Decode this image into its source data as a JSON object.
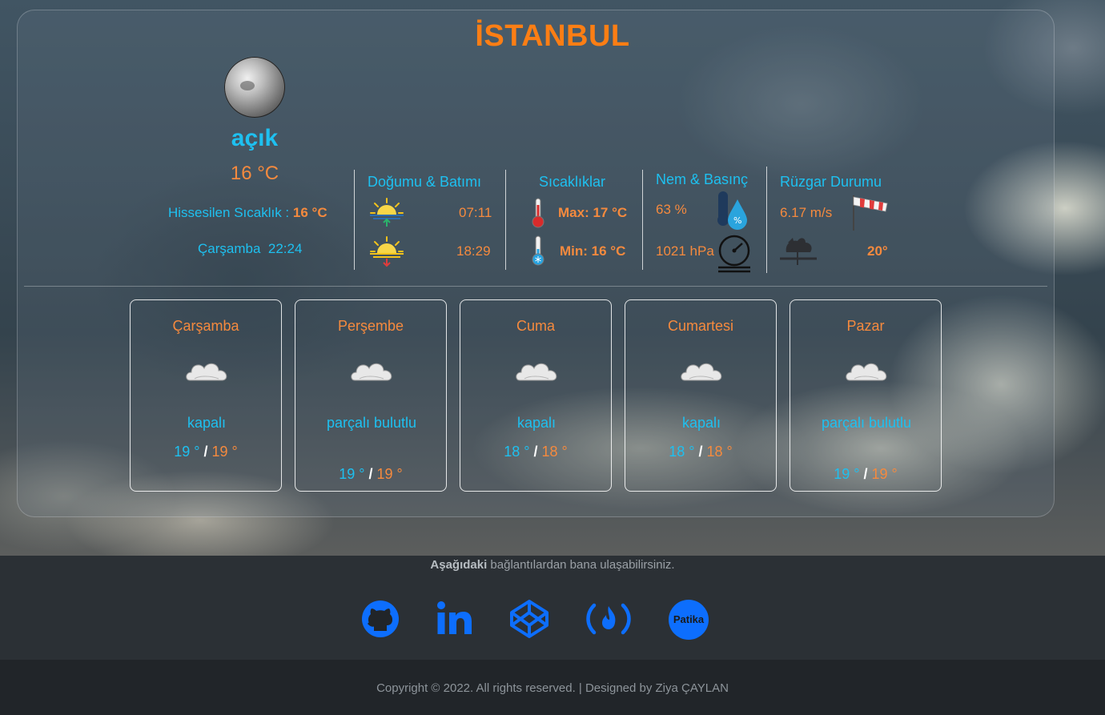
{
  "colors": {
    "accent_orange": "#fd7e14",
    "accent_cyan": "#1ec0f0",
    "link_blue": "#0d6efd"
  },
  "city": "İSTANBUL",
  "current": {
    "icon": "moon-icon",
    "description": "açık",
    "temperature": "16 °C",
    "feels_like_label": "Hissesilen Sıcaklık :",
    "feels_like_value": "16 °C",
    "day": "Çarşamba",
    "time": "22:24"
  },
  "sun": {
    "title": "Doğumu & Batımı",
    "sunrise": "07:11",
    "sunset": "18:29"
  },
  "temps": {
    "title": "Sıcaklıklar",
    "max": "Max: 17 °C",
    "min": "Min: 16 °C"
  },
  "humidity": {
    "title": "Nem & Basınç",
    "humidity": "63 %",
    "pressure": "1021 hPa"
  },
  "wind": {
    "title": "Rüzgar Durumu",
    "speed": "6.17 m/s",
    "direction": "20°"
  },
  "forecast": [
    {
      "day": "Çarşamba",
      "desc": "kapalı",
      "min": "19 °",
      "sep": "/",
      "max": "19 °"
    },
    {
      "day": "Perşembe",
      "desc": "parçalı bulutlu",
      "min": "19 °",
      "sep": "/",
      "max": "19 °"
    },
    {
      "day": "Cuma",
      "desc": "kapalı",
      "min": "18 °",
      "sep": "/",
      "max": "18 °"
    },
    {
      "day": "Cumartesi",
      "desc": "kapalı",
      "min": "18 °",
      "sep": "/",
      "max": "18 °"
    },
    {
      "day": "Pazar",
      "desc": "parçalı bulutlu",
      "min": "19 °",
      "sep": "/",
      "max": "19 °"
    }
  ],
  "footer": {
    "contact_bold": "Aşağıdaki",
    "contact_rest": " bağlantılardan bana ulaşabilirsiniz.",
    "social": [
      {
        "name": "github-icon"
      },
      {
        "name": "linkedin-icon"
      },
      {
        "name": "codepen-icon"
      },
      {
        "name": "freecodecamp-icon"
      },
      {
        "name": "patika-icon",
        "label": "Patika"
      }
    ],
    "copyright": "Copyright © 2022. All rights reserved. | Designed by Ziya ÇAYLAN"
  }
}
